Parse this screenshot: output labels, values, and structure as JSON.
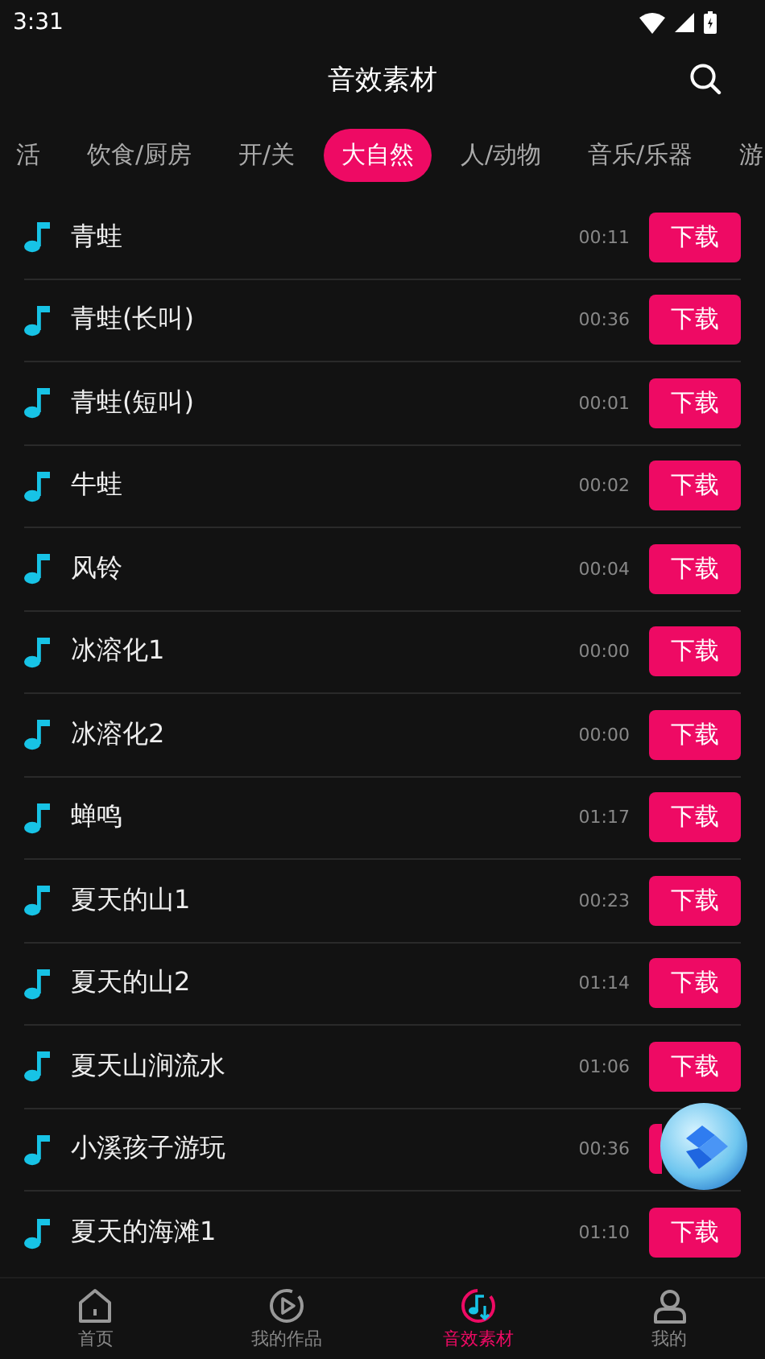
{
  "status_bar": {
    "time": "3:31"
  },
  "header": {
    "title": "音效素材"
  },
  "tabs": [
    {
      "label": "活",
      "selected": false
    },
    {
      "label": "饮食/厨房",
      "selected": false
    },
    {
      "label": "开/关",
      "selected": false
    },
    {
      "label": "大自然",
      "selected": true
    },
    {
      "label": "人/动物",
      "selected": false
    },
    {
      "label": "音乐/乐器",
      "selected": false
    },
    {
      "label": "游",
      "selected": false
    }
  ],
  "sounds": [
    {
      "name": "青蛙",
      "duration": "00:11",
      "button": "下载"
    },
    {
      "name": "青蛙(长叫)",
      "duration": "00:36",
      "button": "下载"
    },
    {
      "name": "青蛙(短叫)",
      "duration": "00:01",
      "button": "下载"
    },
    {
      "name": "牛蛙",
      "duration": "00:02",
      "button": "下载"
    },
    {
      "name": "风铃",
      "duration": "00:04",
      "button": "下载"
    },
    {
      "name": "冰溶化1",
      "duration": "00:00",
      "button": "下载"
    },
    {
      "name": "冰溶化2",
      "duration": "00:00",
      "button": "下载"
    },
    {
      "name": "蝉鸣",
      "duration": "01:17",
      "button": "下载"
    },
    {
      "name": "夏天的山1",
      "duration": "00:23",
      "button": "下载"
    },
    {
      "name": "夏天的山2",
      "duration": "01:14",
      "button": "下载"
    },
    {
      "name": "夏天山涧流水",
      "duration": "01:06",
      "button": "下载"
    },
    {
      "name": "小溪孩子游玩",
      "duration": "00:36"
    },
    {
      "name": "夏天的海滩1",
      "duration": "01:10",
      "button": "下载"
    }
  ],
  "bottom_nav": [
    {
      "label": "首页",
      "kind": "home",
      "selected": false
    },
    {
      "label": "我的作品",
      "kind": "works",
      "selected": false
    },
    {
      "label": "音效素材",
      "kind": "sounds",
      "selected": true
    },
    {
      "label": "我的",
      "kind": "me",
      "selected": false
    }
  ]
}
